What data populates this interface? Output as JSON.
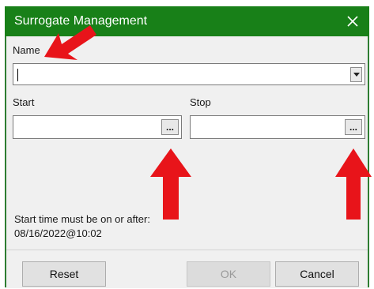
{
  "window": {
    "title": "Surrogate Management",
    "close_icon": "close-icon"
  },
  "form": {
    "name_label": "Name",
    "name_value": "",
    "start_label": "Start",
    "start_value": "",
    "start_button_label": "...",
    "stop_label": "Stop",
    "stop_value": "",
    "stop_button_label": "..."
  },
  "info": {
    "line1": "Start time must be on or after:",
    "line2": "08/16/2022@10:02"
  },
  "buttons": {
    "reset": "Reset",
    "ok": "OK",
    "cancel": "Cancel"
  },
  "colors": {
    "titlebar": "#188018",
    "annotation_arrow": "#e8141a"
  }
}
